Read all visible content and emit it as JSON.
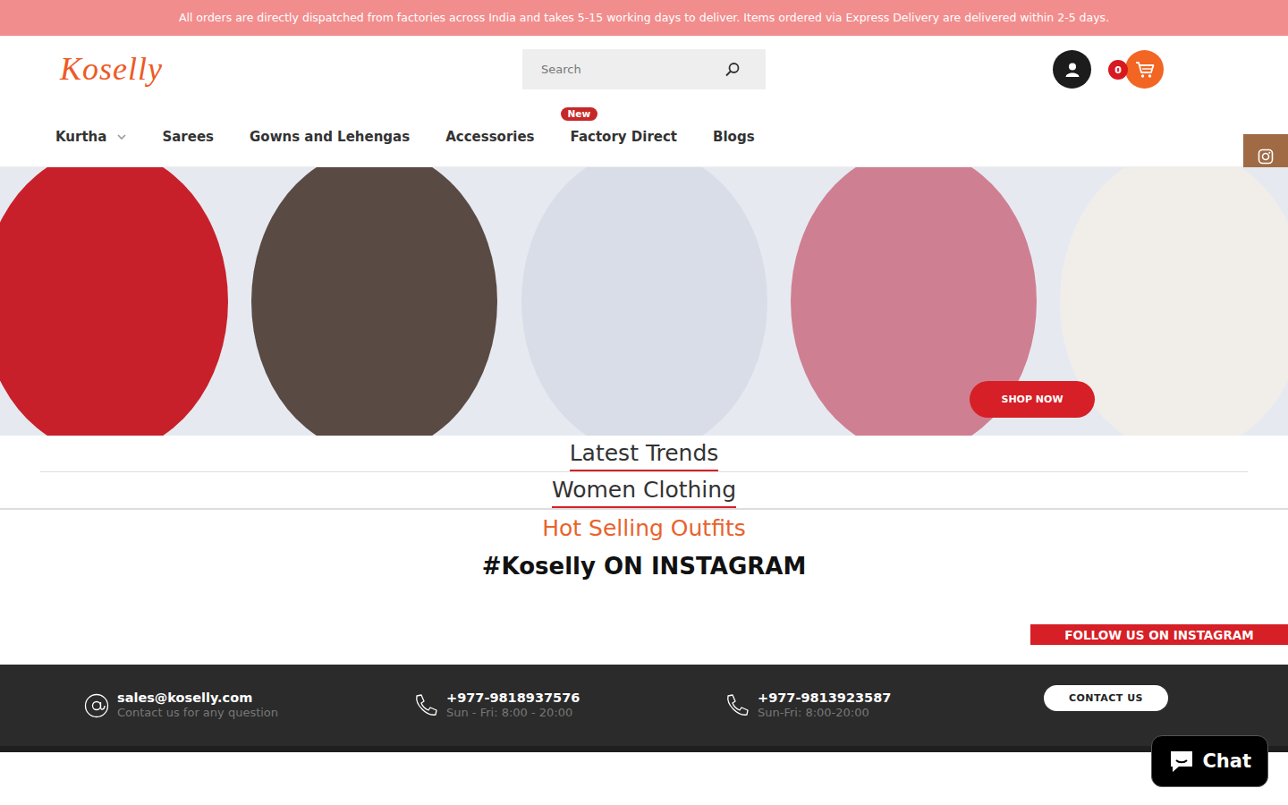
{
  "announcement": "All orders are directly dispatched from factories across India and takes 5-15 working days to deliver. Items ordered via Express Delivery are delivered within 2-5 days.",
  "logo": "Koselly",
  "search": {
    "placeholder": "Search"
  },
  "cart": {
    "count": "0"
  },
  "nav": [
    {
      "label": "Kurtha",
      "has_dropdown": true,
      "badge": ""
    },
    {
      "label": "Sarees",
      "has_dropdown": false,
      "badge": ""
    },
    {
      "label": "Gowns and Lehengas",
      "has_dropdown": false,
      "badge": ""
    },
    {
      "label": "Accessories",
      "has_dropdown": false,
      "badge": ""
    },
    {
      "label": "Factory Direct",
      "has_dropdown": false,
      "badge": "New"
    },
    {
      "label": "Blogs",
      "has_dropdown": false,
      "badge": ""
    }
  ],
  "hero": {
    "button": "SHOP NOW"
  },
  "sections": [
    {
      "title": "Latest Trends",
      "kind": "underlined"
    },
    {
      "title": "Women Clothing",
      "kind": "underlined"
    },
    {
      "title": "Hot Selling Outfits",
      "kind": "accent"
    },
    {
      "title": "#Koselly ON INSTAGRAM",
      "kind": "bold"
    }
  ],
  "instagram": {
    "follow": "FOLLOW US ON INSTAGRAM"
  },
  "footer": {
    "contacts": [
      {
        "kind": "email",
        "value": "sales@koselly.com",
        "note": "Contact us for any question"
      },
      {
        "kind": "phone",
        "value": "+977-9818937576",
        "note": "Sun - Fri: 8:00 - 20:00"
      },
      {
        "kind": "phone",
        "value": "+977-9813923587",
        "note": "Sun-Fri: 8:00-20:00"
      }
    ],
    "button": "CONTACT US"
  },
  "chat": {
    "label": "Chat"
  }
}
